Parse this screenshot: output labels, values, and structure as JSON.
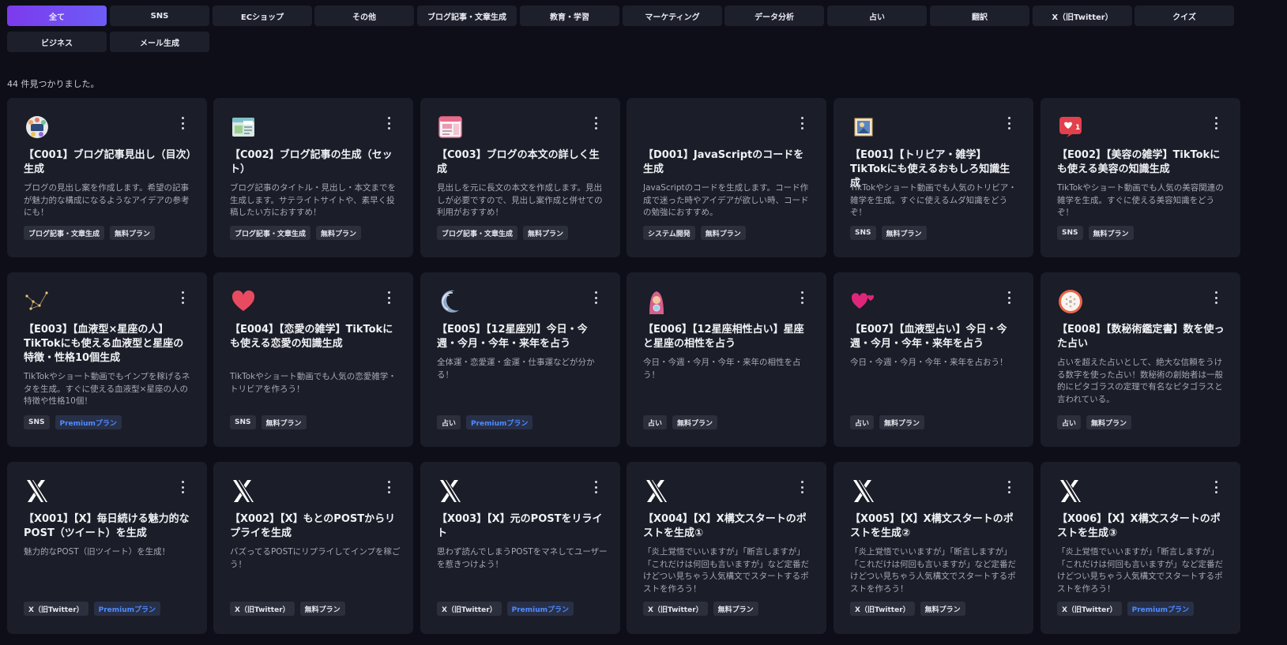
{
  "filters": [
    "全て",
    "SNS",
    "ECショップ",
    "その他",
    "ブログ記事・文章生成",
    "教育・学習",
    "マーケティング",
    "データ分析",
    "占い",
    "翻訳",
    "X（旧Twitter）",
    "クイズ",
    "ビジネス",
    "メール生成"
  ],
  "result_count": "44 件見つかりました。",
  "cards": [
    {
      "title": "【C001】ブログ記事見出し（目次）生成",
      "desc": "ブログの見出し案を作成します。希望の記事が魅力的な構成になるようなアイデアの参考にも！",
      "tag1": "ブログ記事・文章生成",
      "tag2": "無料プラン",
      "icon": "team-icon"
    },
    {
      "title": "【C002】ブログ記事の生成（セット）",
      "desc": "ブログ記事のタイトル・見出し・本文までを生成します。サテライトサイトや、素早く投稿したい方におすすめ！",
      "tag1": "ブログ記事・文章生成",
      "tag2": "無料プラン",
      "icon": "blog-icon"
    },
    {
      "title": "【C003】ブログの本文の詳しく生成",
      "desc": "見出しを元に長文の本文を作成します。見出しが必要ですので、見出し案作成と併せての利用がおすすめ！",
      "tag1": "ブログ記事・文章生成",
      "tag2": "無料プラン",
      "icon": "webpage-icon"
    },
    {
      "title": "【D001】JavaScriptのコードを生成",
      "desc": "JavaScriptのコードを生成します。コード作成で迷った時やアイデアが欲しい時、コードの勉強におすすめ。",
      "tag1": "システム開発",
      "tag2": "無料プラン",
      "icon": "none"
    },
    {
      "title": "【E001】【トリビア・雑学】TikTokにも使えるおもしろ知識生成",
      "desc": "TikTokやショート動画でも人気のトリビア・雑学を生成。すぐに使えるムダ知識をどうぞ！",
      "tag1": "SNS",
      "tag2": "無料プラン",
      "icon": "photo-icon"
    },
    {
      "title": "【E002】【美容の雑学】TikTokにも使える美容の知識生成",
      "desc": "TikTokやショート動画でも人気の美容関連の雑学を生成。すぐに使える美容知識をどうぞ！",
      "tag1": "SNS",
      "tag2": "無料プラン",
      "icon": "like-notification-icon",
      "badge": "1"
    },
    {
      "title": "【E003】【血液型×星座の人】TikTokにも使える血液型と星座の特徴・性格10個生成",
      "desc": "TikTokやショート動画でもインプを稼げるネタを生成。すぐに使える血液型×星座の人の特徴や性格10個！",
      "tag1": "SNS",
      "tag2": "Premiumプラン",
      "icon": "constellation-icon"
    },
    {
      "title": "【E004】【恋愛の雑学】TikTokにも使える恋愛の知識生成",
      "desc": "TikTokやショート動画でも人気の恋愛雑学・トリビアを作ろう！",
      "tag1": "SNS",
      "tag2": "無料プラン",
      "icon": "heart-icon"
    },
    {
      "title": "【E005】【12星座別】今日・今週・今月・今年・来年を占う",
      "desc": "全体運・恋愛運・金運・仕事運などが分かる！",
      "tag1": "占い",
      "tag2": "Premiumプラン",
      "icon": "moon-icon"
    },
    {
      "title": "【E006】【12星座相性占い】星座と星座の相性を占う",
      "desc": "今日・今週・今月・今年・来年の相性を占う！",
      "tag1": "占い",
      "tag2": "無料プラン",
      "icon": "fortune-teller-icon"
    },
    {
      "title": "【E007】【血液型占い】今日・今週・今月・今年・来年を占う",
      "desc": "今日・今週・今月・今年・来年を占おう！",
      "tag1": "占い",
      "tag2": "無料プラン",
      "icon": "hearts-icon"
    },
    {
      "title": "【E008】【数秘術鑑定書】数を使った占い",
      "desc": "占いを超えた占いとして、絶大な信頼をうける数字を使った占い！数秘術の創始者は一般的にピタゴラスの定理で有名なピタゴラスと言われている。",
      "tag1": "占い",
      "tag2": "無料プラン",
      "icon": "numerology-icon"
    },
    {
      "title": "【X001】【X】毎日続ける魅力的なPOST（ツイート）を生成",
      "desc": "魅力的なPOST（旧ツイート）を生成！",
      "tag1": "X（旧Twitter）",
      "tag2": "Premiumプラン",
      "icon": "x-logo-icon"
    },
    {
      "title": "【X002】【X】もとのPOSTからリプライを生成",
      "desc": "バズってるPOSTにリプライしてインプを稼ごう！",
      "tag1": "X（旧Twitter）",
      "tag2": "無料プラン",
      "icon": "x-logo-icon"
    },
    {
      "title": "【X003】【X】元のPOSTをリライト",
      "desc": "思わず読んでしまうPOSTをマネしてユーザーを惹きつけよう！",
      "tag1": "X（旧Twitter）",
      "tag2": "Premiumプラン",
      "icon": "x-logo-icon"
    },
    {
      "title": "【X004】【X】X構文スタートのポストを生成①",
      "desc": "「炎上覚悟でいいますが」「断言しますが」「これだけは何回も言いますが」など定番だけどつい見ちゃう人気構文でスタートするポストを作ろう！",
      "tag1": "X（旧Twitter）",
      "tag2": "無料プラン",
      "icon": "x-logo-icon"
    },
    {
      "title": "【X005】【X】X構文スタートのポストを生成②",
      "desc": "「炎上覚悟でいいますが」「断言しますが」「これだけは何回も言いますが」など定番だけどつい見ちゃう人気構文でスタートするポストを作ろう！",
      "tag1": "X（旧Twitter）",
      "tag2": "無料プラン",
      "icon": "x-logo-icon"
    },
    {
      "title": "【X006】【X】X構文スタートのポストを生成③",
      "desc": "「炎上覚悟でいいますが」「断言しますが」「これだけは何回も言いますが」など定番だけどつい見ちゃう人気構文でスタートするポストを作ろう！",
      "tag1": "X（旧Twitter）",
      "tag2": "Premiumプラン",
      "icon": "x-logo-icon"
    }
  ]
}
